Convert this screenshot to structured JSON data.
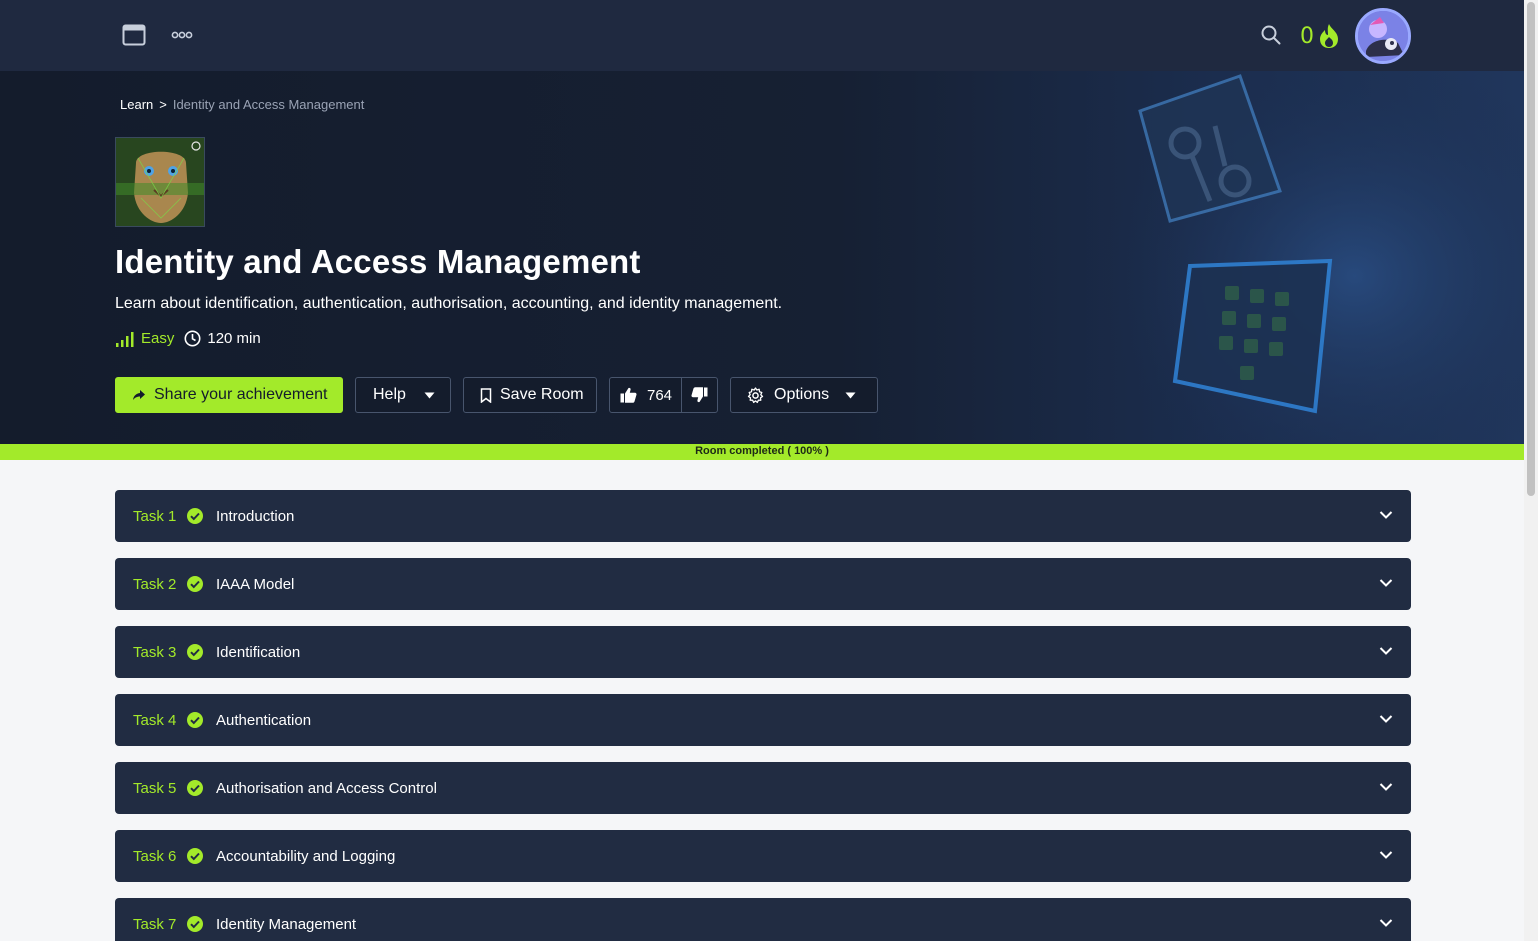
{
  "topbar": {
    "streak_count": "0",
    "icons": {
      "browser": "browser-window-icon",
      "more": "more-dots-icon",
      "search": "search-icon",
      "streak": "flame-icon"
    }
  },
  "breadcrumb": {
    "root": "Learn",
    "separator": ">",
    "current": "Identity and Access Management"
  },
  "room": {
    "title": "Identity and Access Management",
    "description": "Learn about identification, authentication, authorisation, accounting, and identity management.",
    "difficulty": "Easy",
    "duration": "120 min"
  },
  "actions": {
    "share": "Share your achievement",
    "help": "Help",
    "save": "Save Room",
    "upvotes": "764",
    "options": "Options"
  },
  "progress": {
    "label": "Room completed ( 100% )",
    "value": 1.0
  },
  "tasks": [
    {
      "number": "Task 1",
      "title": "Introduction",
      "completed": true
    },
    {
      "number": "Task 2",
      "title": "IAAA Model",
      "completed": true
    },
    {
      "number": "Task 3",
      "title": "Identification",
      "completed": true
    },
    {
      "number": "Task 4",
      "title": "Authentication",
      "completed": true
    },
    {
      "number": "Task 5",
      "title": "Authorisation and Access Control",
      "completed": true
    },
    {
      "number": "Task 6",
      "title": "Accountability and Logging",
      "completed": true
    },
    {
      "number": "Task 7",
      "title": "Identity Management",
      "completed": true
    }
  ],
  "colors": {
    "accent": "#a3ea2a",
    "topbar": "#1f2940",
    "task_bg": "#212c42",
    "hero": "#141c2c"
  }
}
